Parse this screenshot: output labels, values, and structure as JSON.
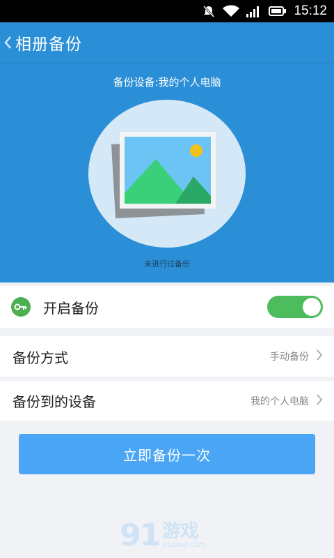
{
  "status_bar": {
    "time": "15:12",
    "icons": [
      "notifications-off-icon",
      "wifi-icon",
      "signal-icon",
      "battery-icon"
    ]
  },
  "header": {
    "back_icon": "chevron-left-icon",
    "title": "相册备份"
  },
  "hero": {
    "device_label": "备份设备:我的个人电脑",
    "illustration": "photo-stack-icon",
    "status": "未进行过备份"
  },
  "settings": {
    "backup_toggle": {
      "label": "开启备份",
      "icon": "key-icon",
      "enabled": true
    },
    "backup_method": {
      "label": "备份方式",
      "value": "手动备份"
    },
    "backup_device": {
      "label": "备份到的设备",
      "value": "我的个人电脑"
    }
  },
  "actions": {
    "backup_now": "立即备份一次"
  },
  "watermark": {
    "logo": "91",
    "main": "游戏",
    "sub": "91danji.com"
  },
  "colors": {
    "primary": "#2a8fd6",
    "button": "#4aa6f4",
    "toggle_on": "#4cbc5c",
    "background": "#f0f2f5"
  }
}
